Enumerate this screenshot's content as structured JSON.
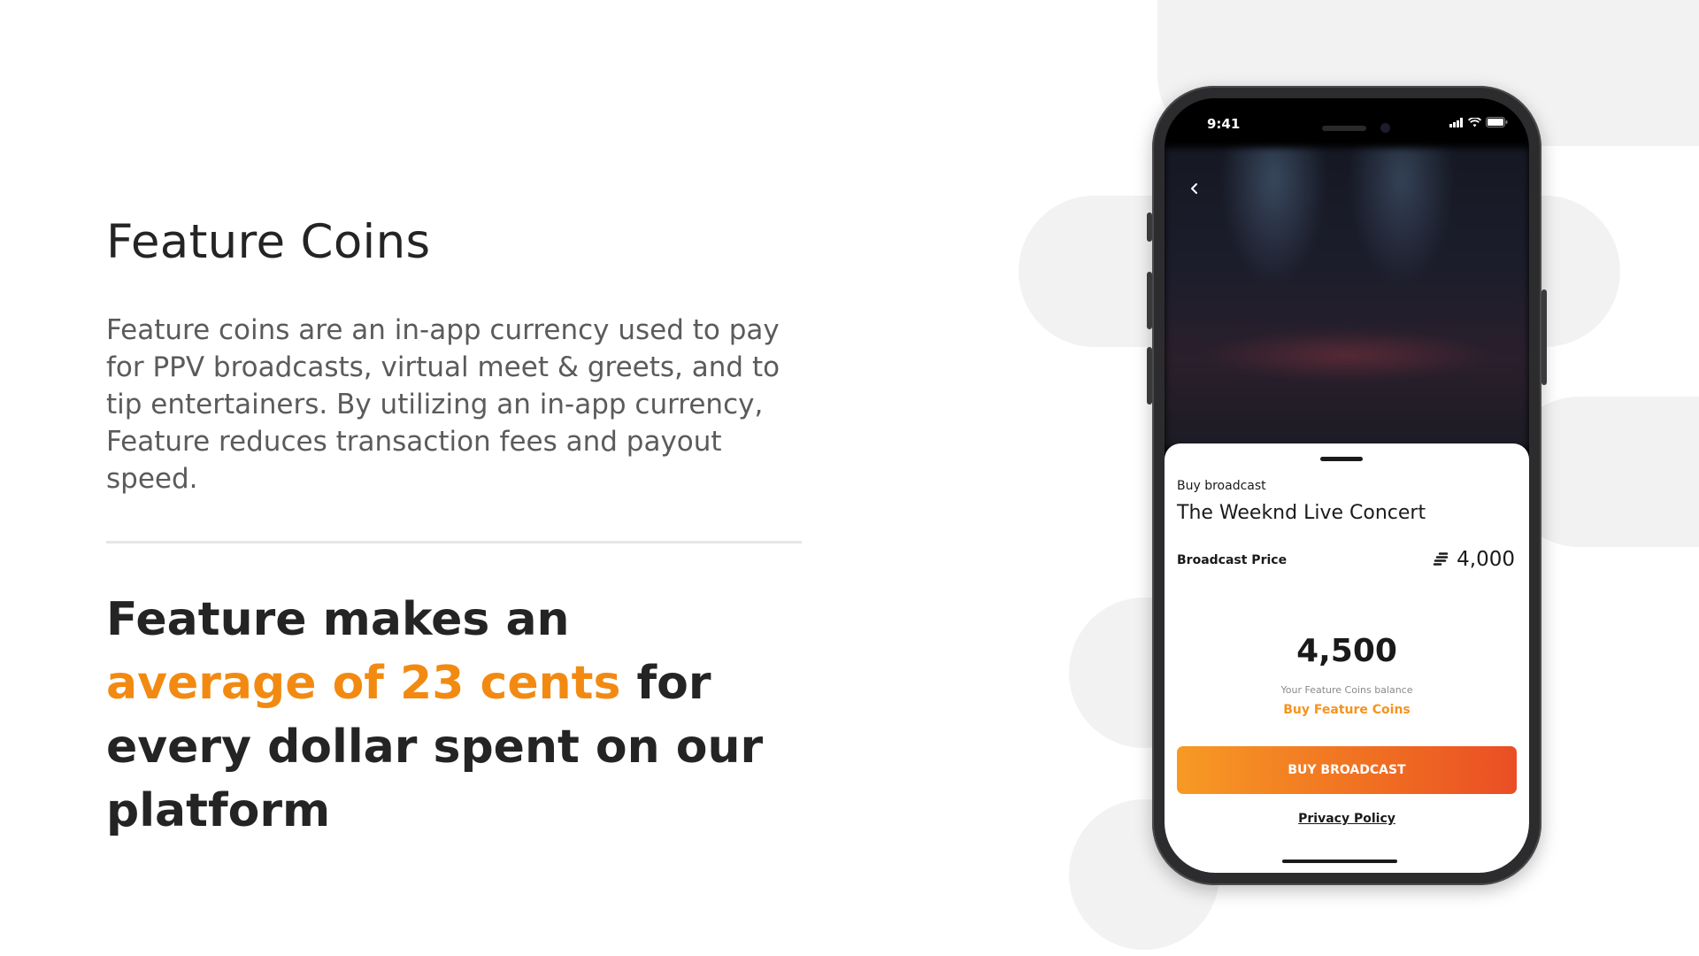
{
  "slide": {
    "title": "Feature Coins",
    "description": "Feature coins are an in-app currency used to pay for PPV broadcasts, virtual meet & greets, and to tip entertainers. By utilizing an in-app currency, Feature reduces transaction fees and payout speed.",
    "headline_start": "Feature makes an",
    "headline_accent": "average of 23 cents",
    "headline_end": "for every dollar spent on our platform",
    "accent_color": "#f28a12",
    "logo_icon": "feature-logo-icon"
  },
  "phone": {
    "status_time": "9:41",
    "status_icons": [
      "signal-icon",
      "wifi-icon",
      "battery-icon"
    ],
    "back_icon": "chevron-left-icon",
    "sheet": {
      "label": "Buy broadcast",
      "title": "The Weeknd Live Concert",
      "price_label": "Broadcast Price",
      "price_value": "4,000",
      "balance_value": "4,500",
      "balance_caption": "Your Feature Coins balance",
      "buy_coins_label": "Buy Feature Coins",
      "buy_button_label": "BUY BROADCAST",
      "privacy_label": "Privacy Policy",
      "button_gradient": [
        "#f79a24",
        "#ea4e24"
      ],
      "link_color": "#f5931d"
    }
  }
}
